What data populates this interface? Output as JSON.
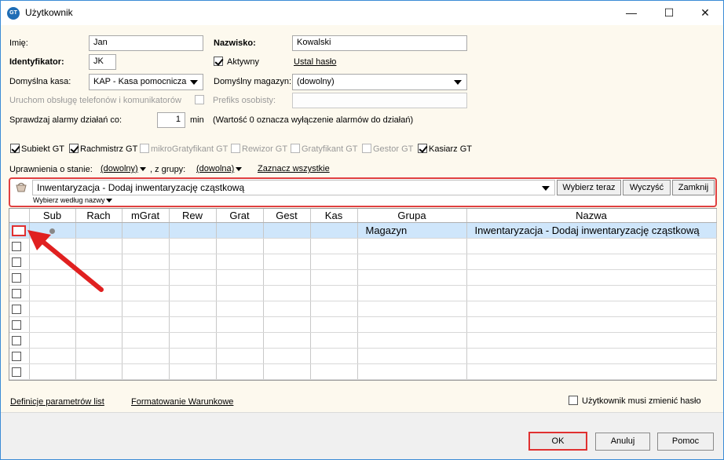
{
  "window": {
    "title": "Użytkownik",
    "min_glyph": "—",
    "max_glyph": "☐",
    "close_glyph": "✕",
    "icon_text": "GT"
  },
  "form": {
    "imie_label": "Imię:",
    "imie_value": "Jan",
    "nazwisko_label": "Nazwisko:",
    "nazwisko_value": "Kowalski",
    "identyfikator_label": "Identyfikator:",
    "identyfikator_value": "JK",
    "aktywny_label": "Aktywny",
    "aktywny_checked": true,
    "ustal_haslo_label": "Ustal hasło",
    "kasa_label": "Domyślna kasa:",
    "kasa_value": "KAP - Kasa pomocnicza",
    "magazyn_label": "Domyślny magazyn:",
    "magazyn_value": "(dowolny)",
    "uruchom_label": "Uruchom obsługę telefonów i komunikatorów",
    "prefiks_label": "Prefiks osobisty:",
    "prefiks_value": "",
    "alarmy_label": "Sprawdzaj alarmy działań co:",
    "alarmy_value": "1",
    "alarmy_unit": "min",
    "alarmy_hint": "(Wartość 0 oznacza wyłączenie alarmów do działań)"
  },
  "modules": [
    {
      "label": "Subiekt GT",
      "checked": true,
      "enabled": true
    },
    {
      "label": "Rachmistrz GT",
      "checked": true,
      "enabled": true
    },
    {
      "label": "mikroGratyfikant GT",
      "checked": false,
      "enabled": false
    },
    {
      "label": "Rewizor GT",
      "checked": false,
      "enabled": false
    },
    {
      "label": "Gratyfikant GT",
      "checked": false,
      "enabled": false
    },
    {
      "label": "Gestor GT",
      "checked": false,
      "enabled": false
    },
    {
      "label": "Kasiarz GT",
      "checked": true,
      "enabled": true
    }
  ],
  "permissions": {
    "state_label": "Uprawnienia o stanie:",
    "state_value": "(dowolny)",
    "group_label": ", z grupy:",
    "group_value": "(dowolna)",
    "select_all": "Zaznacz wszystkie"
  },
  "filter": {
    "value": "Inwentaryzacja - Dodaj inwentaryzację cząstkową",
    "mode": "Wybierz według nazwy",
    "btn_choose": "Wybierz teraz",
    "btn_clear": "Wyczyść",
    "btn_close": "Zamknij",
    "icon": "basket-icon"
  },
  "table": {
    "columns": [
      "",
      "Sub",
      "Rach",
      "mGrat",
      "Rew",
      "Grat",
      "Gest",
      "Kas",
      "Grupa",
      "Nazwa"
    ],
    "rows": [
      {
        "sub": "●",
        "grupa": "Magazyn",
        "nazwa": "Inwentaryzacja - Dodaj inwentaryzację cząstkową",
        "selected": true
      }
    ],
    "empty_rows": 9
  },
  "links": {
    "definicje": "Definicje parametrów list",
    "formatowanie": "Formatowanie Warunkowe",
    "musi_zmienic": "Użytkownik musi zmienić hasło"
  },
  "buttons": {
    "ok": "OK",
    "anuluj": "Anuluj",
    "pomoc": "Pomoc"
  },
  "colors": {
    "highlight": "#e03030",
    "selection": "#cfe6fb",
    "dialog_bg": "#fdf9ee"
  }
}
